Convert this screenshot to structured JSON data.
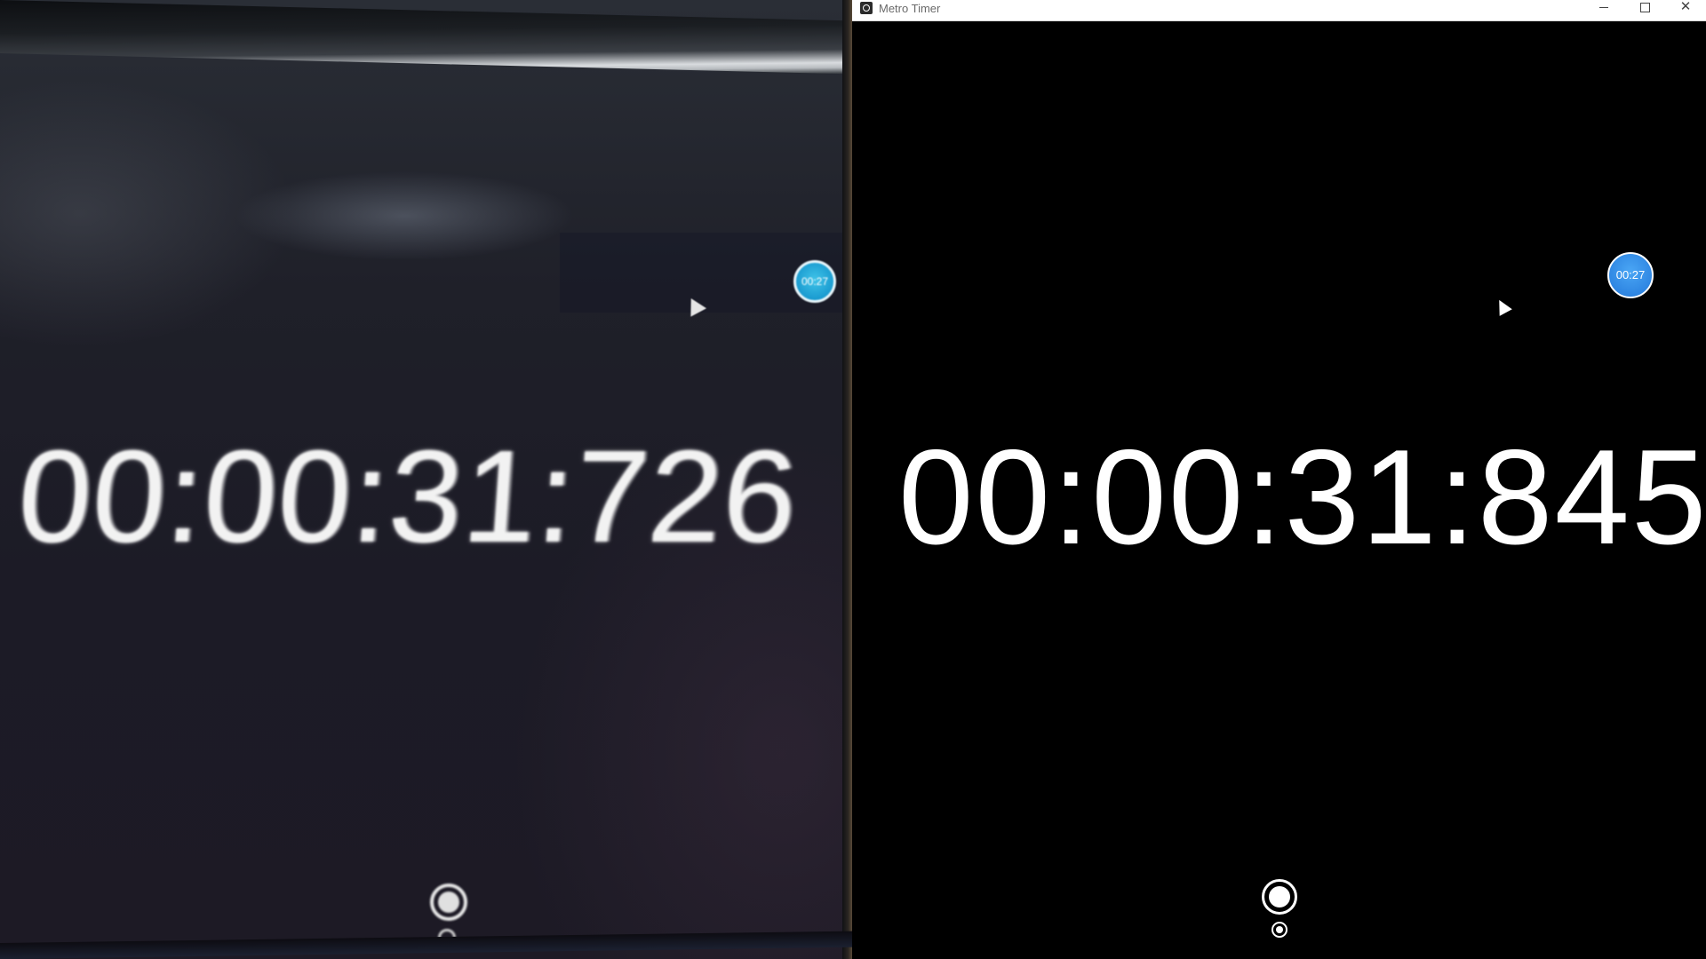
{
  "photo": {
    "timer_text": "00:00:31:",
    "timer_ms_visible": "726",
    "badge_text": "00:27"
  },
  "window": {
    "title": "Metro Timer",
    "controls": {
      "minimize": "─",
      "maximize": "☐",
      "close": "✕"
    },
    "timer_display": "00:00:31:845",
    "lap_badge": "00:27",
    "colors": {
      "background": "#000000",
      "text": "#ffffff",
      "accent": "#2f86e2"
    },
    "icons": {
      "app": "stopwatch-icon",
      "start": "record-icon",
      "lap": "lap-icon"
    }
  }
}
